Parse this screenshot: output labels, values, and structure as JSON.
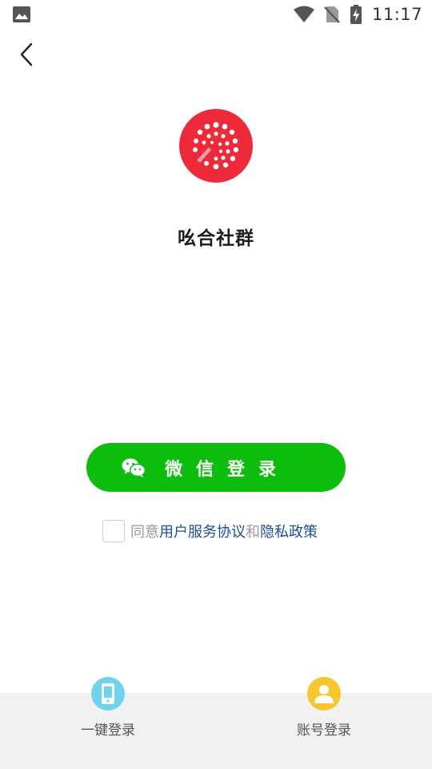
{
  "status_bar": {
    "time": "11:17",
    "icons": [
      "gallery-icon",
      "wifi-icon",
      "no-sim-icon",
      "battery-charging-icon"
    ]
  },
  "header": {
    "back_icon": "chevron-left-icon"
  },
  "app": {
    "name": "吆合社群",
    "logo_color": "#ee2a3a"
  },
  "wechat_login": {
    "label": "微信登录",
    "color": "#0cbd0c",
    "icon": "wechat-icon"
  },
  "agreement": {
    "checked": false,
    "prefix": "同意",
    "terms_link": "用户服务协议",
    "joiner": "和",
    "privacy_link": "隐私政策",
    "link_color": "#1b4e9e"
  },
  "bottom_options": [
    {
      "label": "一键登录",
      "icon": "phone-icon",
      "color": "#6fd3f0"
    },
    {
      "label": "账号登录",
      "icon": "user-icon",
      "color": "#f7c52c"
    }
  ]
}
